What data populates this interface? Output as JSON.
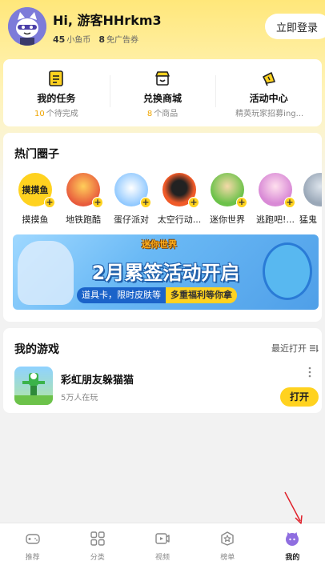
{
  "header": {
    "greeting": "Hi, 游客HHrkm3",
    "coins_value": "45",
    "coins_label": "小鱼币",
    "ad_free_value": "8",
    "ad_free_label": "免广告券",
    "login_label": "立即登录"
  },
  "quick": [
    {
      "title": "我的任务",
      "num": "10",
      "sub": "个待完成",
      "icon": "task-list-icon"
    },
    {
      "title": "兑换商城",
      "num": "8",
      "sub": "个商品",
      "icon": "shop-icon"
    },
    {
      "title": "活动中心",
      "num": "",
      "sub": "精英玩家招募ing...",
      "icon": "megaphone-icon"
    }
  ],
  "hot": {
    "title": "热门圈子",
    "items": [
      {
        "label": "摸摸鱼",
        "badge_text": "摸摸鱼",
        "color": "#ffd21f"
      },
      {
        "label": "地铁跑酷",
        "color": "#e85a3c"
      },
      {
        "label": "蛋仔派对",
        "color": "#8fc8ff"
      },
      {
        "label": "太空行动...",
        "color": "#f05a28"
      },
      {
        "label": "迷你世界",
        "color": "#6cc24a"
      },
      {
        "label": "逃跑吧!...",
        "color": "#d98ad6"
      },
      {
        "label": "猛鬼",
        "color": "#9aa8b8"
      }
    ],
    "plus_symbol": "+"
  },
  "banner": {
    "logo": "迷你世界",
    "title": "2月累签活动开启",
    "pill_left": "道具卡，限时皮肤等",
    "pill_right": "多重福利等你拿"
  },
  "games": {
    "title": "我的游戏",
    "recent_label": "最近打开",
    "items": [
      {
        "name": "彩虹朋友躲猫猫",
        "players": "5万人在玩",
        "open_label": "打开"
      }
    ]
  },
  "nav": [
    {
      "label": "推荐",
      "icon": "gamepad-icon",
      "active": false
    },
    {
      "label": "分类",
      "icon": "grid-icon",
      "active": false
    },
    {
      "label": "视频",
      "icon": "video-icon",
      "active": false
    },
    {
      "label": "榜单",
      "icon": "star-badge-icon",
      "active": false
    },
    {
      "label": "我的",
      "icon": "profile-avatar-icon",
      "active": true
    }
  ],
  "colors": {
    "accent": "#ffd21f",
    "number": "#f0a500",
    "arrow": "#e0202a"
  }
}
